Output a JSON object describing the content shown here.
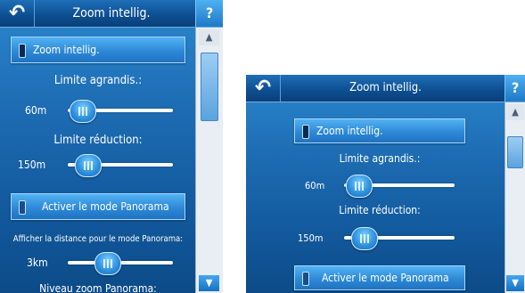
{
  "title": "Zoom intellig.",
  "help_label": "?",
  "back_glyph": "↶",
  "toggle_zoom": "Zoom intellig.",
  "label_limit_zoom_in": "Limite agrandis.:",
  "value_limit_zoom_in": "60m",
  "label_limit_zoom_out": "Limite réduction:",
  "value_limit_zoom_out": "150m",
  "toggle_panorama": "Activer le mode Panorama",
  "label_panorama_distance": "Afficher la distance pour le mode Panorama:",
  "value_panorama_distance": "3km",
  "label_panorama_zoom_level": "Niveau zoom Panorama:",
  "scroll_up": "▲",
  "scroll_down": "▼",
  "icons": {
    "back": "back-arrow-icon",
    "help": "help-icon",
    "toggle": "toggle-indicator-icon",
    "knob": "slider-knob-icon"
  },
  "colors": {
    "background": "#1e6db4",
    "accent": "#2d89d6",
    "text": "#ffffff"
  }
}
